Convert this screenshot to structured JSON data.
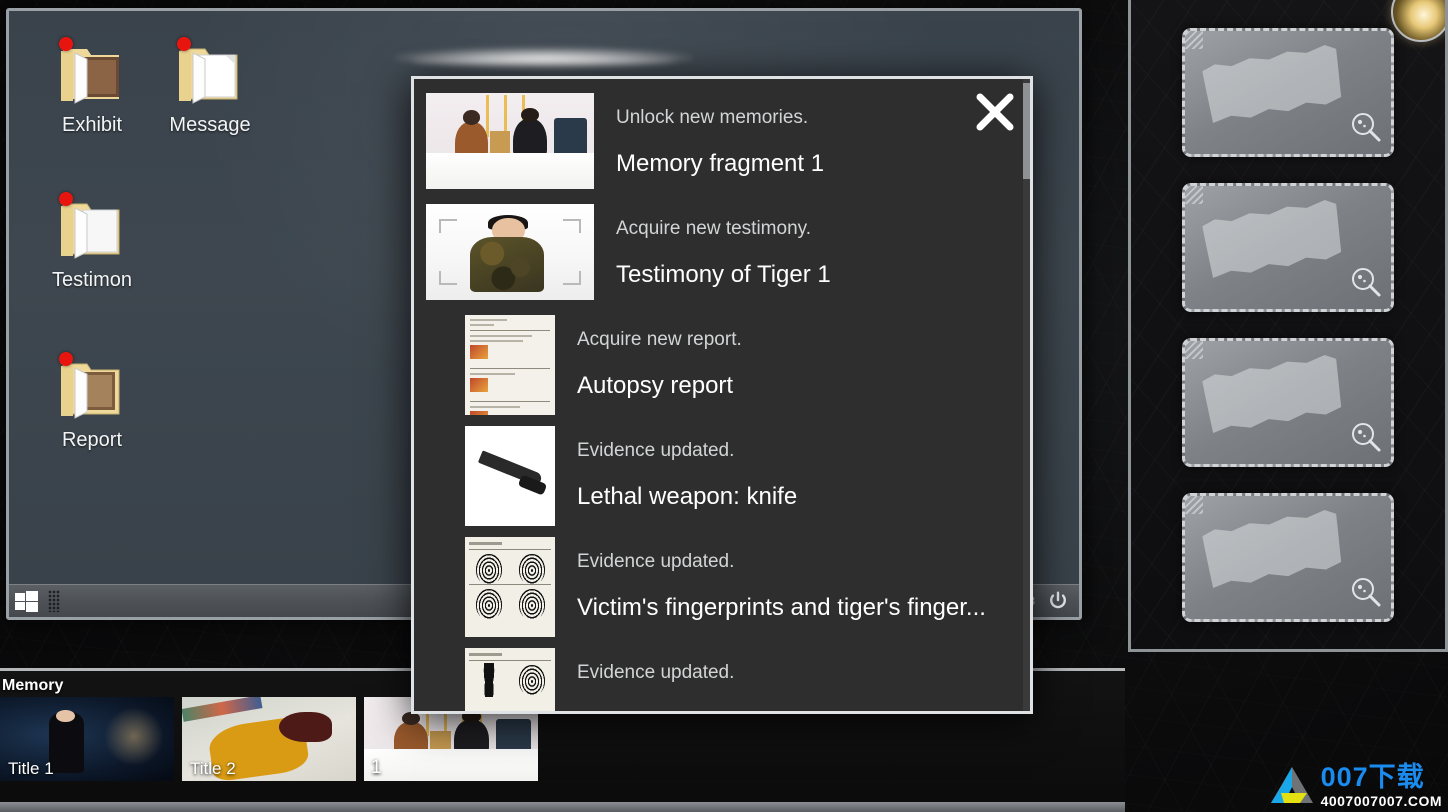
{
  "desktop": {
    "icons": [
      {
        "label": "Exhibit",
        "icon": "folder-icon",
        "badge": true
      },
      {
        "label": "Message",
        "icon": "folder-icon",
        "badge": true
      },
      {
        "label": "Testimon",
        "icon": "folder-icon",
        "badge": true
      },
      {
        "label": "Report",
        "icon": "folder-icon",
        "badge": true
      }
    ],
    "taskbar": {
      "start_icon": "windows-start-icon",
      "grid_icon": "grid-icon",
      "overflow_icon": "overflow-dots-icon",
      "window_count": "3",
      "power_icon": "power-icon"
    }
  },
  "modal": {
    "close_icon": "close-icon",
    "rows": [
      {
        "caption": "Unlock new memories.",
        "title": "Memory fragment 1",
        "thumb": "interview-photo-thumbnail"
      },
      {
        "caption": "Acquire new testimony.",
        "title": "Testimony of Tiger 1",
        "thumb": "testimony-video-thumbnail"
      },
      {
        "caption": "Acquire new report.",
        "title": "Autopsy report",
        "thumb": "autopsy-report-thumbnail"
      },
      {
        "caption": "Evidence updated.",
        "title": "Lethal weapon: knife",
        "thumb": "knife-photo-thumbnail"
      },
      {
        "caption": "Evidence updated.",
        "title": "Victim's fingerprints and tiger's finger...",
        "thumb": "fingerprints-sheet-thumbnail"
      },
      {
        "caption": "Evidence updated.",
        "title": "",
        "thumb": "footprints-sheet-thumbnail"
      }
    ]
  },
  "evidence_panel": {
    "corner_icon": "sun-badge-icon",
    "cards": [
      {
        "magnify_icon": "magnifier-icon",
        "state": "locked"
      },
      {
        "magnify_icon": "magnifier-icon",
        "state": "locked"
      },
      {
        "magnify_icon": "magnifier-icon",
        "state": "locked"
      },
      {
        "magnify_icon": "magnifier-icon",
        "state": "locked"
      }
    ]
  },
  "memory_tray": {
    "label": "Memory",
    "items": [
      {
        "title": "Title 1",
        "art": "night-scene-thumbnail"
      },
      {
        "title": "Title 2",
        "art": "victim-scene-thumbnail"
      },
      {
        "title": "1",
        "art": "interview-photo-thumbnail"
      }
    ]
  },
  "watermark": {
    "main": "007下载",
    "sub": "4007007007.COM",
    "logo_icon": "triangle-logo-icon"
  },
  "colors": {
    "desktop_bg": "#3a434c",
    "modal_bg": "#2e2e2e",
    "modal_border": "#dfe2e4",
    "badge_red": "#e8150f",
    "accent_blue": "#1a8cf0",
    "scene_bg": "#0c0c0d"
  }
}
